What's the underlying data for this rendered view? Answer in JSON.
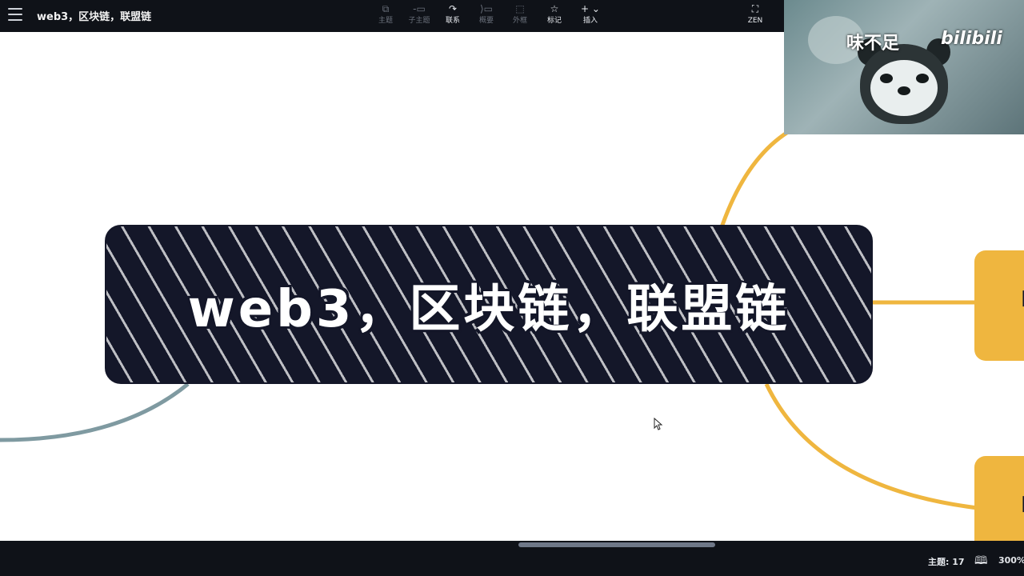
{
  "app": {
    "title": "web3，区块链，联盟链"
  },
  "toolbar": {
    "tools": [
      {
        "id": "topic",
        "icon": "⧉",
        "label": "主题",
        "enabled": false
      },
      {
        "id": "subtopic",
        "icon": "-▭",
        "label": "子主题",
        "enabled": false
      },
      {
        "id": "relationship",
        "icon": "↷",
        "label": "联系",
        "enabled": true
      },
      {
        "id": "summary",
        "icon": "⟩▭",
        "label": "概要",
        "enabled": false
      },
      {
        "id": "boundary",
        "icon": "⬚",
        "label": "外框",
        "enabled": false
      },
      {
        "id": "marker",
        "icon": "☆",
        "label": "标记",
        "enabled": true
      },
      {
        "id": "insert",
        "icon": "+ ⌄",
        "label": "插入",
        "enabled": true
      }
    ],
    "zen": {
      "icon": "⛶",
      "label": "ZEN"
    }
  },
  "webcam": {
    "watermark": "味不足",
    "brand": "bilibili"
  },
  "mindmap": {
    "central_topic": "web3，区块链，联盟链"
  },
  "status": {
    "topics_label": "主题: 17",
    "zoom": "300%"
  },
  "colors": {
    "toolbar_bg": "#0f1218",
    "central_bg": "#141729",
    "branch_yellow": "#efb63f",
    "branch_gray": "#7f9aa1"
  }
}
